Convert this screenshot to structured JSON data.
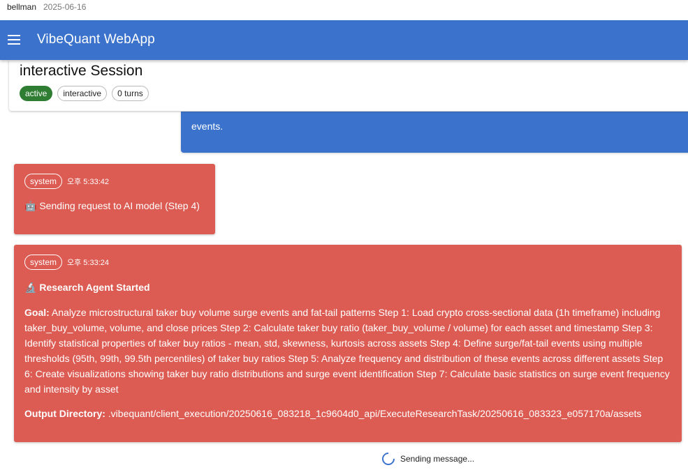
{
  "topbar": {
    "user": "bellman",
    "date": "2025-06-16"
  },
  "appbar": {
    "title": "VibeQuant WebApp",
    "menu_icon": "menu-icon"
  },
  "session": {
    "title": "interactive Session",
    "chips": [
      {
        "label": "active",
        "color": "#2e7d32"
      },
      {
        "label": "interactive"
      },
      {
        "label": "0 turns"
      }
    ]
  },
  "user_message": {
    "text": "events."
  },
  "messages": [
    {
      "role": "system",
      "time": "오후 5:33:42",
      "icon": "🤖",
      "text": "Sending request to AI model (Step 4)"
    },
    {
      "role": "system",
      "time": "오후 5:33:24",
      "icon": "🔬",
      "title": "Research Agent Started",
      "goal_label": "Goal:",
      "goal_text": "Analyze microstructural taker buy volume surge events and fat-tail patterns Step 1: Load crypto cross-sectional data (1h timeframe) including taker_buy_volume, volume, and close prices Step 2: Calculate taker buy ratio (taker_buy_volume / volume) for each asset and timestamp Step 3: Identify statistical properties of taker buy ratios - mean, std, skewness, kurtosis across assets Step 4: Define surge/fat-tail events using multiple thresholds (95th, 99th, 99.5th percentiles) of taker buy ratios Step 5: Analyze frequency and distribution of these events across different assets Step 6: Create visualizations showing taker buy ratio distributions and surge event identification Step 7: Calculate basic statistics on surge event frequency and intensity by asset",
      "output_label": "Output Directory:",
      "output_text": ".vibequant/client_execution/20250616_083218_1c9604d0_api/ExecuteResearchTask/20250616_083323_e057170a/assets"
    }
  ],
  "status": {
    "text": "Sending message..."
  },
  "colors": {
    "appbar": "#3b73cc",
    "system_card": "#dc5b52",
    "active_chip": "#2e7d32"
  }
}
